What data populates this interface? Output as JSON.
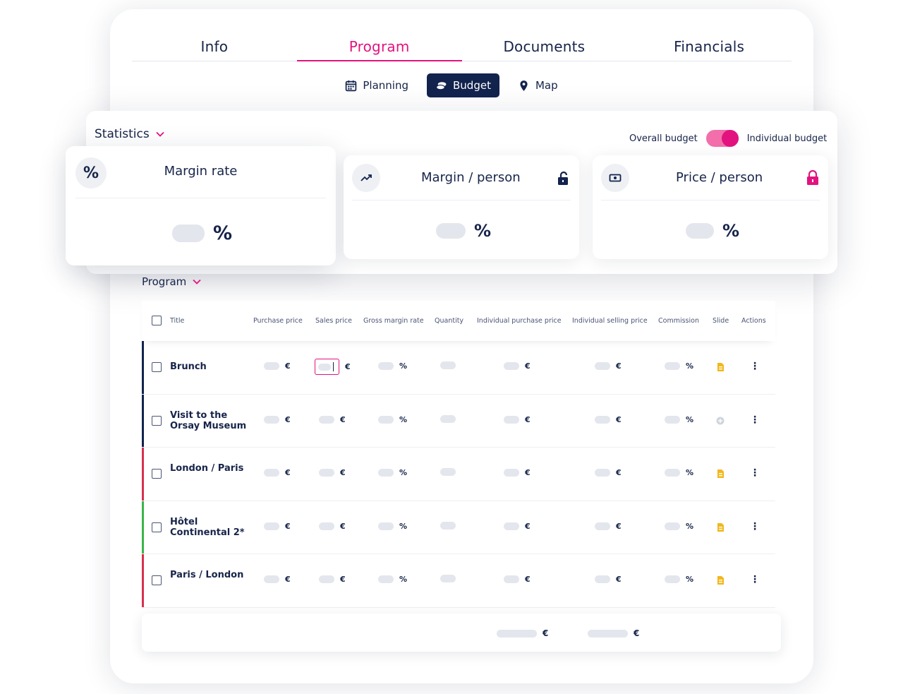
{
  "tabs": [
    {
      "label": "Info"
    },
    {
      "label": "Program"
    },
    {
      "label": "Documents"
    },
    {
      "label": "Financials"
    }
  ],
  "subtabs": [
    {
      "label": "Planning",
      "icon": "calendar-icon"
    },
    {
      "label": "Budget",
      "icon": "coins-icon"
    },
    {
      "label": "Map",
      "icon": "map-pin-icon"
    }
  ],
  "statistics": {
    "title": "Statistics",
    "toggle": {
      "left_label": "Overall budget",
      "right_label": "Individual budget",
      "state": "individual"
    },
    "cards": [
      {
        "title": "Margin rate",
        "unit": "%",
        "icon": "percent-icon",
        "lock": "none"
      },
      {
        "title": "Margin / person",
        "unit": "%",
        "icon": "trend-up-icon",
        "lock": "unlocked"
      },
      {
        "title": "Price / person",
        "unit": "%",
        "icon": "cash-icon",
        "lock": "locked"
      }
    ]
  },
  "program": {
    "title": "Program",
    "columns": [
      "Title",
      "Purchase price",
      "Sales price",
      "Gross margin rate",
      "Quantity",
      "Individual purchase price",
      "Individual selling price",
      "Commission",
      "Slide",
      "Actions"
    ],
    "rows": [
      {
        "title": "Brunch",
        "color": "#12234d",
        "slide": "document"
      },
      {
        "title": "Visit to the Orsay Museum",
        "color": "#12234d",
        "slide": "add"
      },
      {
        "title": "London / Paris",
        "color": "#d9304f",
        "slide": "document"
      },
      {
        "title": "Hôtel Continental 2*",
        "color": "#3bb54a",
        "slide": "document"
      },
      {
        "title": "Paris / London",
        "color": "#d9304f",
        "slide": "document"
      }
    ],
    "currency": "€",
    "percent": "%",
    "actions_icon": "⋮"
  },
  "footer": {
    "totals": [
      "€",
      "€"
    ]
  },
  "colors": {
    "accent": "#e2137f",
    "navy": "#12234d",
    "slide_icon": "#f2b71c"
  }
}
